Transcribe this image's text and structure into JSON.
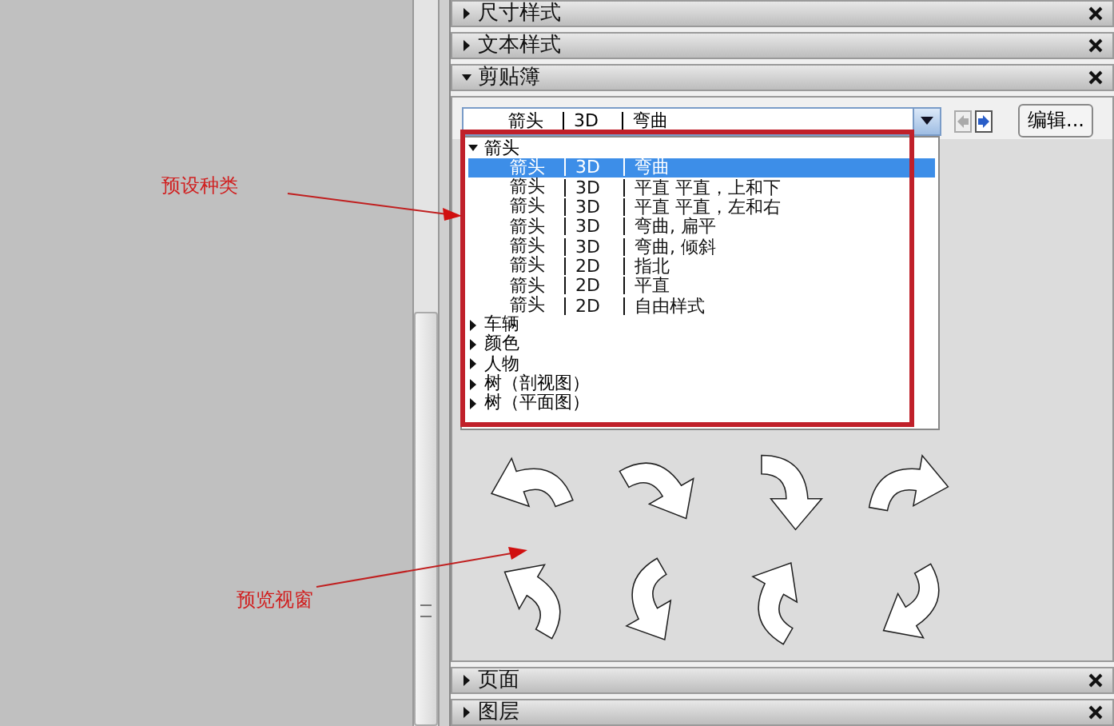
{
  "panels_top": [
    {
      "title": "尺寸样式",
      "expanded": false
    },
    {
      "title": "文本样式",
      "expanded": false
    },
    {
      "title": "剪贴簿",
      "expanded": true
    }
  ],
  "clipbook": {
    "combo": {
      "name": "箭头",
      "dim": "3D",
      "style": "弯曲"
    },
    "edit_button": "编辑...",
    "list": [
      {
        "label": "箭头",
        "expanded": true,
        "children": [
          {
            "name": "箭头",
            "dim": "3D",
            "style": "弯曲",
            "selected": true
          },
          {
            "name": "箭头",
            "dim": "3D",
            "style": "平直 平直，上和下",
            "selected": false
          },
          {
            "name": "箭头",
            "dim": "3D",
            "style": "平直 平直，左和右",
            "selected": false
          },
          {
            "name": "箭头",
            "dim": "3D",
            "style": "弯曲, 扁平",
            "selected": false
          },
          {
            "name": "箭头",
            "dim": "3D",
            "style": "弯曲, 倾斜",
            "selected": false
          },
          {
            "name": "箭头",
            "dim": "2D",
            "style": "指北",
            "selected": false
          },
          {
            "name": "箭头",
            "dim": "2D",
            "style": "平直",
            "selected": false
          },
          {
            "name": "箭头",
            "dim": "2D",
            "style": "自由样式",
            "selected": false
          }
        ]
      },
      {
        "label": "车辆",
        "expanded": false
      },
      {
        "label": "颜色",
        "expanded": false
      },
      {
        "label": "人物",
        "expanded": false
      },
      {
        "label": "树（剖视图）",
        "expanded": false
      },
      {
        "label": "树（平面图）",
        "expanded": false
      }
    ]
  },
  "panels_bottom": [
    {
      "title": "页面",
      "expanded": false
    },
    {
      "title": "图层",
      "expanded": false
    }
  ],
  "annotations": [
    {
      "text": "预设种类"
    },
    {
      "text": "预览视窗"
    }
  ]
}
